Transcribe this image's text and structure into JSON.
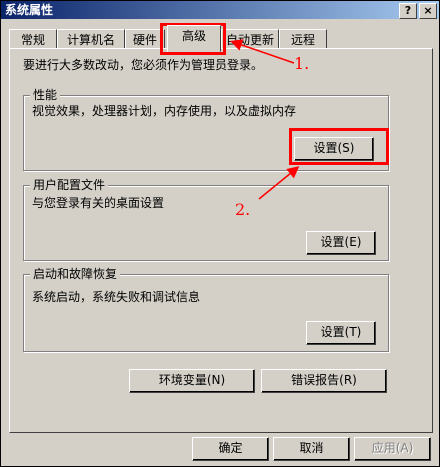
{
  "window": {
    "title": "系统属性",
    "help_button": "?",
    "close_button": "×"
  },
  "tabs": [
    {
      "label": "常规"
    },
    {
      "label": "计算机名"
    },
    {
      "label": "硬件"
    },
    {
      "label": "高级",
      "active": true
    },
    {
      "label": "自动更新"
    },
    {
      "label": "远程"
    }
  ],
  "notice": "要进行大多数改动，您必须作为管理员登录。",
  "performance": {
    "title": "性能",
    "description": "视觉效果，处理器计划，内存使用，以及虚拟内存",
    "button": "设置(S)"
  },
  "user_profiles": {
    "title": "用户配置文件",
    "description": "与您登录有关的桌面设置",
    "button": "设置(E)"
  },
  "startup_recovery": {
    "title": "启动和故障恢复",
    "description": "系统启动，系统失败和调试信息",
    "button": "设置(T)"
  },
  "extra_buttons": {
    "env_vars": "环境变量(N)",
    "error_report": "错误报告(R)"
  },
  "footer": {
    "ok": "确定",
    "cancel": "取消",
    "apply": "应用(A)"
  },
  "annotations": {
    "step1": "1.",
    "step2": "2."
  },
  "colors": {
    "annotation": "#ff0000",
    "titlebar_start": "#0a246a",
    "titlebar_end": "#a6caf0",
    "face": "#d4d0c8"
  }
}
